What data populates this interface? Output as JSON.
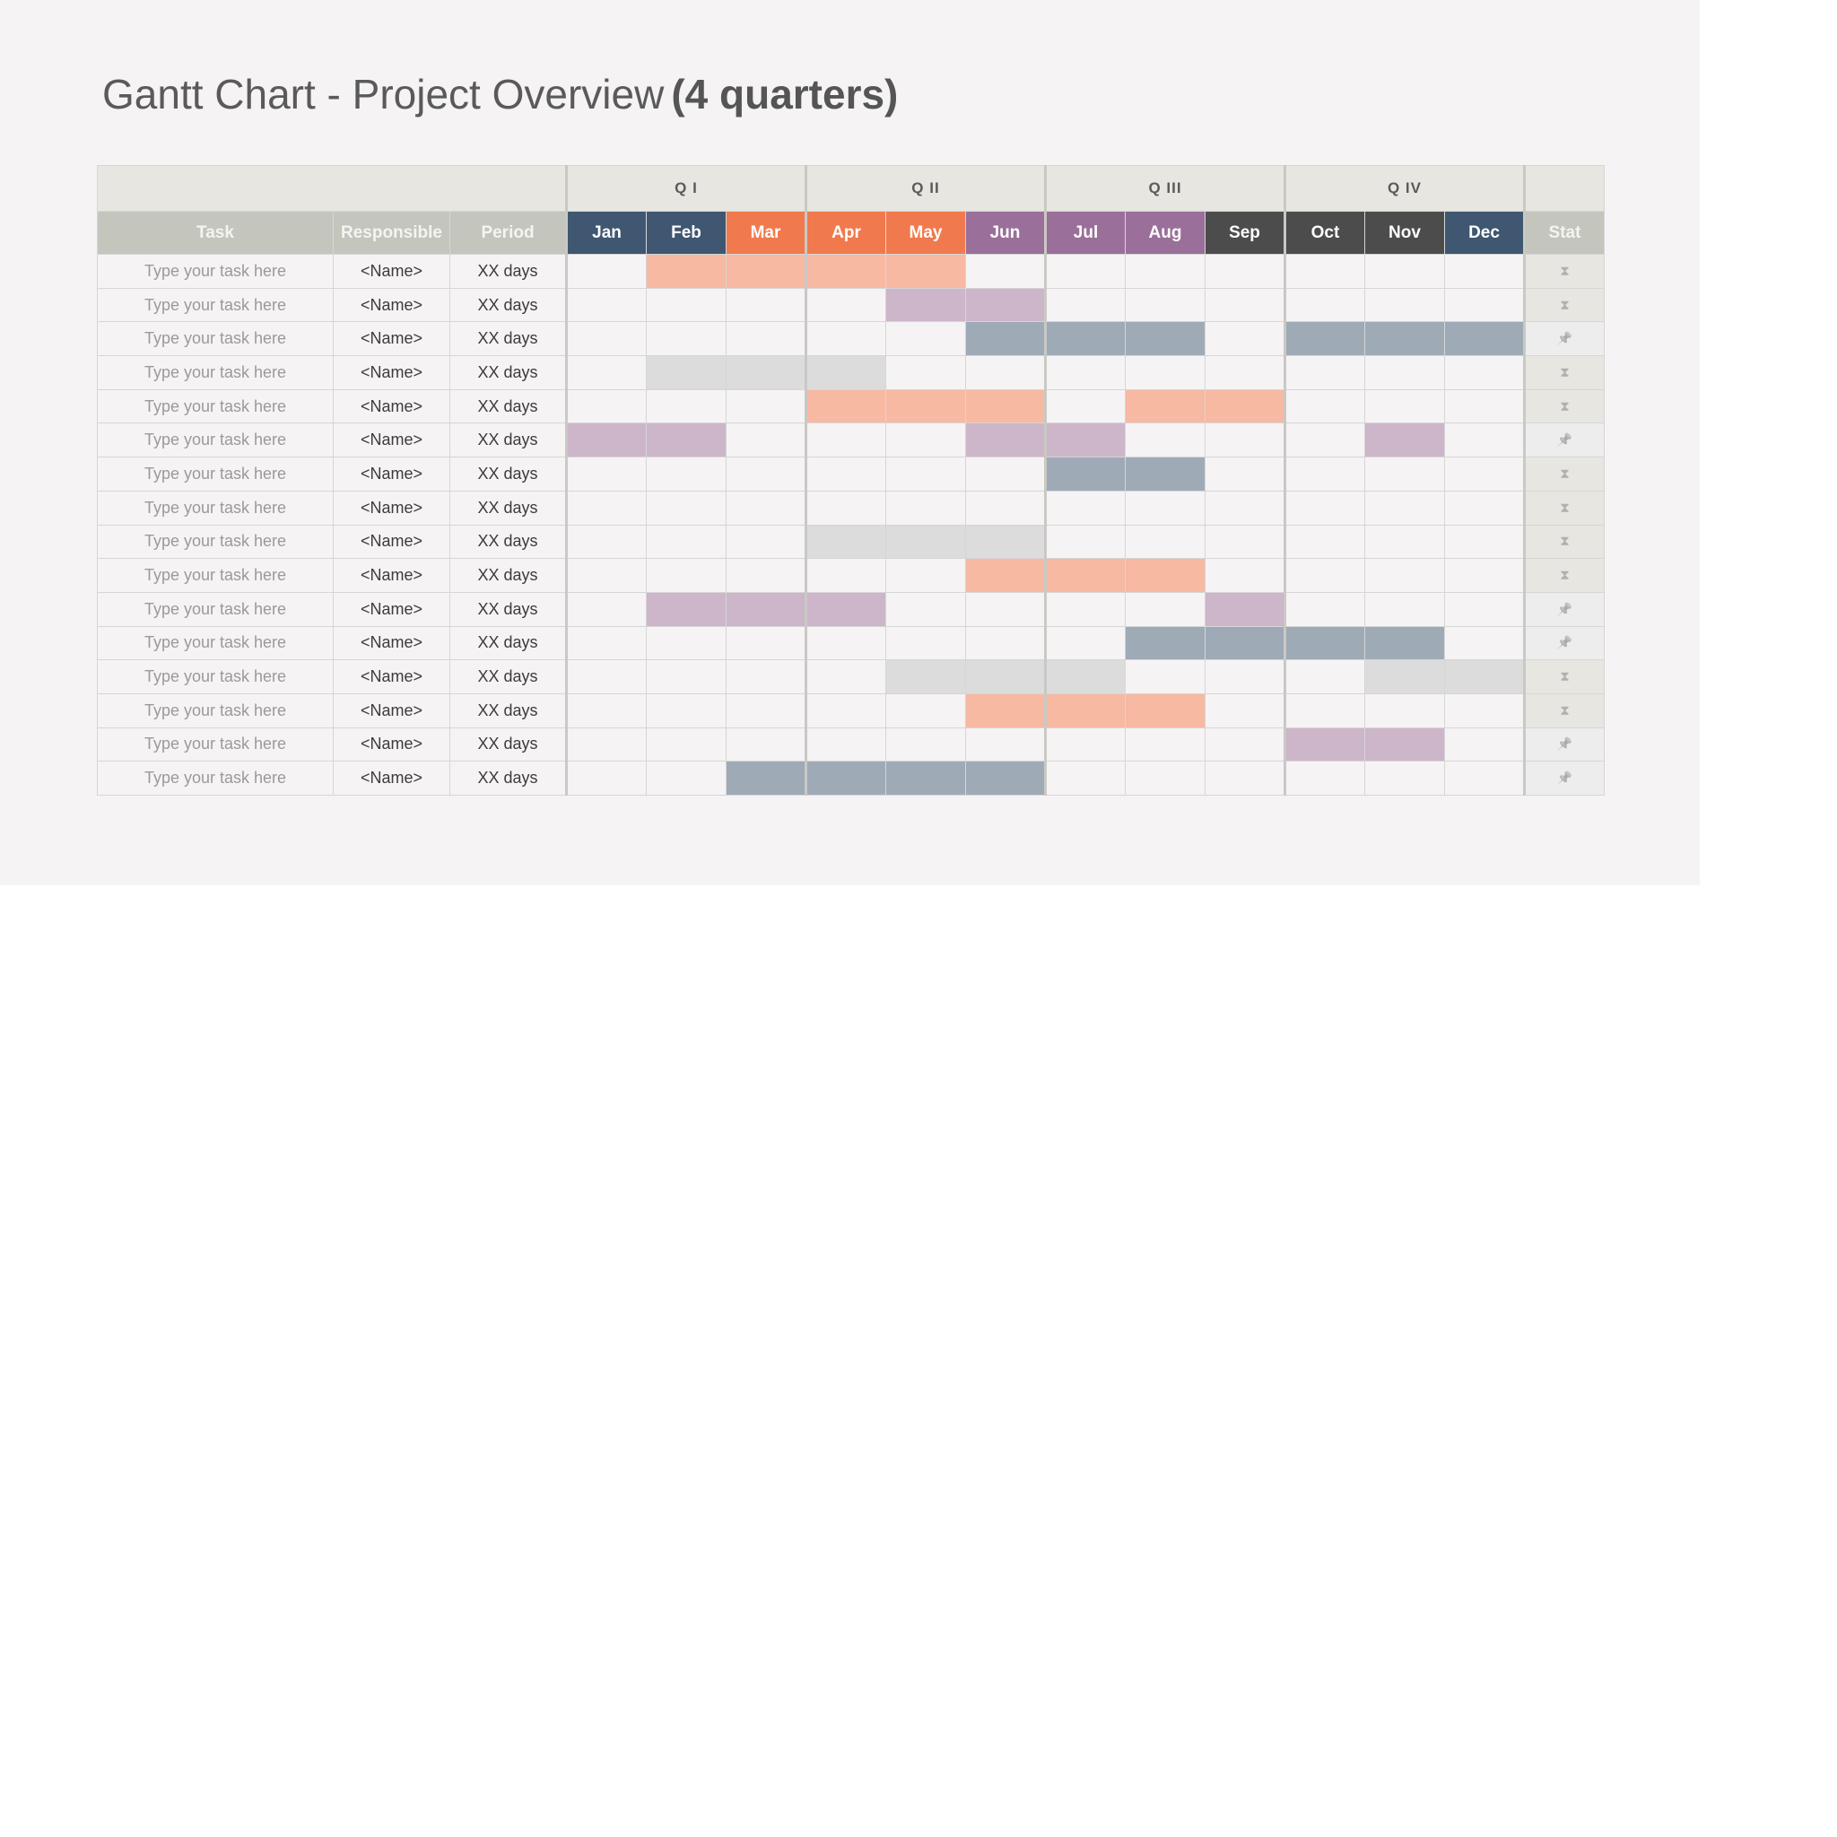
{
  "title": {
    "main": "Gantt Chart - Project Overview",
    "bold": "(4 quarters)"
  },
  "quarters": [
    "Q I",
    "Q II",
    "Q III",
    "Q IV"
  ],
  "columns": {
    "task": "Task",
    "responsible": "Responsible",
    "period": "Period",
    "status": "Stat"
  },
  "months": [
    {
      "label": "Jan",
      "color": "#3f5770"
    },
    {
      "label": "Feb",
      "color": "#3f5770"
    },
    {
      "label": "Mar",
      "color": "#f07a4e"
    },
    {
      "label": "Apr",
      "color": "#f07a4e"
    },
    {
      "label": "May",
      "color": "#f07a4e"
    },
    {
      "label": "Jun",
      "color": "#9a709a"
    },
    {
      "label": "Jul",
      "color": "#9a709a"
    },
    {
      "label": "Aug",
      "color": "#9a709a"
    },
    {
      "label": "Sep",
      "color": "#4c4c4c"
    },
    {
      "label": "Oct",
      "color": "#4c4c4c"
    },
    {
      "label": "Nov",
      "color": "#4c4c4c"
    },
    {
      "label": "Dec",
      "color": "#3f5770"
    }
  ],
  "colors": {
    "orange": "#f7b9a2",
    "purple": "#cdb5ca",
    "blue": "#9faab7",
    "gray": "#dcdcdc"
  },
  "status_icons": {
    "hourglass": "⧗",
    "pin": "📌"
  },
  "tasks": [
    {
      "task": "Type your task here",
      "responsible": "<Name>",
      "period": "XX days",
      "status": "hourglass",
      "bars": [
        {
          "color": "orange",
          "months": [
            2,
            3,
            4,
            5
          ]
        }
      ]
    },
    {
      "task": "Type your task here",
      "responsible": "<Name>",
      "period": "XX days",
      "status": "hourglass",
      "bars": [
        {
          "color": "purple",
          "months": [
            5,
            6
          ]
        }
      ]
    },
    {
      "task": "Type your task here",
      "responsible": "<Name>",
      "period": "XX days",
      "status": "pin",
      "bars": [
        {
          "color": "blue",
          "months": [
            6,
            7,
            8
          ]
        },
        {
          "color": "blue",
          "months": [
            10,
            11,
            12
          ]
        }
      ]
    },
    {
      "task": "Type your task here",
      "responsible": "<Name>",
      "period": "XX days",
      "status": "hourglass",
      "bars": [
        {
          "color": "gray",
          "months": [
            2,
            3,
            4
          ]
        }
      ]
    },
    {
      "task": "Type your task here",
      "responsible": "<Name>",
      "period": "XX days",
      "status": "hourglass",
      "bars": [
        {
          "color": "orange",
          "months": [
            4,
            5,
            6
          ]
        },
        {
          "color": "orange",
          "months": [
            8,
            9
          ]
        }
      ]
    },
    {
      "task": "Type your task here",
      "responsible": "<Name>",
      "period": "XX days",
      "status": "pin",
      "bars": [
        {
          "color": "purple",
          "months": [
            1,
            2
          ]
        },
        {
          "color": "purple",
          "months": [
            6,
            7
          ]
        },
        {
          "color": "purple",
          "months": [
            11
          ]
        }
      ]
    },
    {
      "task": "Type your task here",
      "responsible": "<Name>",
      "period": "XX days",
      "status": "hourglass",
      "bars": [
        {
          "color": "blue",
          "months": [
            7,
            8
          ]
        }
      ]
    },
    {
      "task": "Type your task here",
      "responsible": "<Name>",
      "period": "XX days",
      "status": "hourglass",
      "bars": []
    },
    {
      "task": "Type your task here",
      "responsible": "<Name>",
      "period": "XX days",
      "status": "hourglass",
      "bars": [
        {
          "color": "gray",
          "months": [
            4,
            5,
            6
          ]
        }
      ]
    },
    {
      "task": "Type your task here",
      "responsible": "<Name>",
      "period": "XX days",
      "status": "hourglass",
      "bars": [
        {
          "color": "orange",
          "months": [
            6,
            7,
            8
          ]
        }
      ]
    },
    {
      "task": "Type your task here",
      "responsible": "<Name>",
      "period": "XX days",
      "status": "pin",
      "bars": [
        {
          "color": "purple",
          "months": [
            2,
            3,
            4
          ]
        },
        {
          "color": "purple",
          "months": [
            9
          ]
        }
      ]
    },
    {
      "task": "Type your task here",
      "responsible": "<Name>",
      "period": "XX days",
      "status": "pin",
      "bars": [
        {
          "color": "blue",
          "months": [
            8,
            9,
            10,
            11
          ]
        }
      ]
    },
    {
      "task": "Type your task here",
      "responsible": "<Name>",
      "period": "XX days",
      "status": "hourglass",
      "bars": [
        {
          "color": "gray",
          "months": [
            5,
            6,
            7
          ]
        },
        {
          "color": "gray",
          "months": [
            11,
            12
          ]
        }
      ]
    },
    {
      "task": "Type your task here",
      "responsible": "<Name>",
      "period": "XX days",
      "status": "hourglass",
      "bars": [
        {
          "color": "orange",
          "months": [
            6,
            7,
            8
          ]
        }
      ]
    },
    {
      "task": "Type your task here",
      "responsible": "<Name>",
      "period": "XX days",
      "status": "pin",
      "bars": [
        {
          "color": "purple",
          "months": [
            10,
            11
          ]
        }
      ]
    },
    {
      "task": "Type your task here",
      "responsible": "<Name>",
      "period": "XX days",
      "status": "pin",
      "bars": [
        {
          "color": "blue",
          "months": [
            3,
            4,
            5,
            6
          ]
        }
      ]
    }
  ]
}
